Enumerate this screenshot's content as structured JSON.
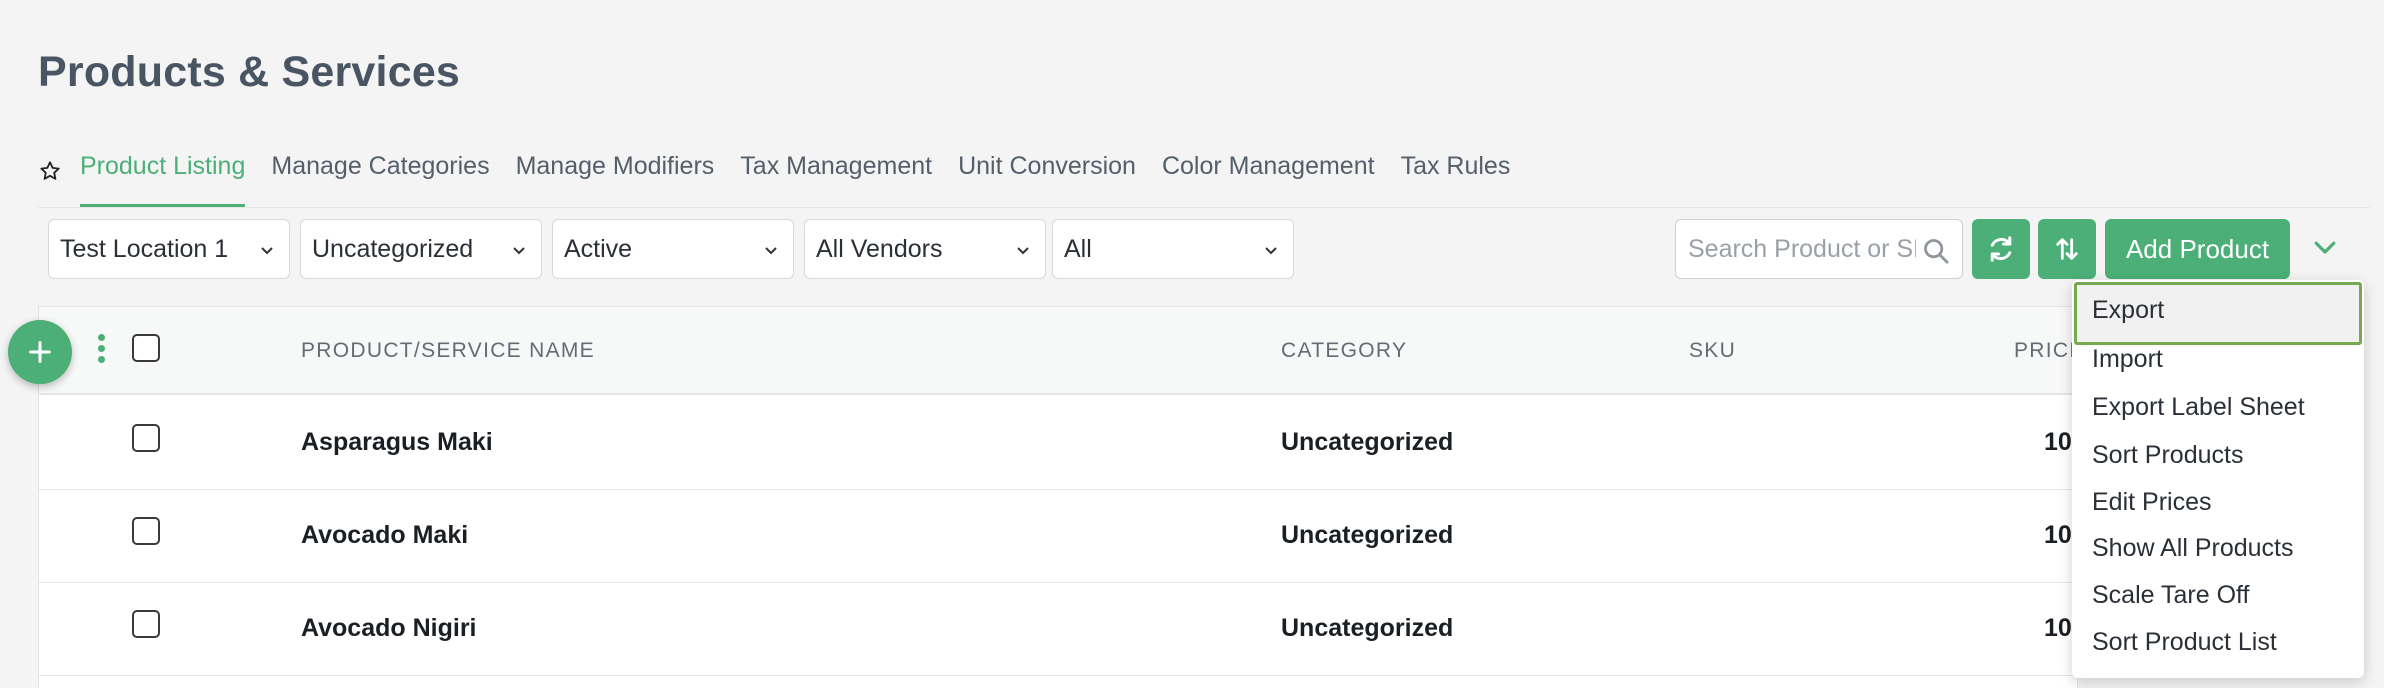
{
  "page": {
    "title": "Products & Services"
  },
  "tabs": [
    {
      "label": "Product Listing",
      "active": true
    },
    {
      "label": "Manage Categories"
    },
    {
      "label": "Manage Modifiers"
    },
    {
      "label": "Tax Management"
    },
    {
      "label": "Unit Conversion"
    },
    {
      "label": "Color Management"
    },
    {
      "label": "Tax Rules"
    }
  ],
  "filters": {
    "location": "Test Location 1",
    "category": "Uncategorized",
    "status": "Active",
    "vendor": "All Vendors",
    "type": "All"
  },
  "search": {
    "placeholder": "Search Product or SKU"
  },
  "toolbar": {
    "add_label": "Add Product"
  },
  "table": {
    "headers": {
      "name": "PRODUCT/SERVICE NAME",
      "category": "CATEGORY",
      "sku": "SKU",
      "price": "PRICE"
    },
    "rows": [
      {
        "name": "Asparagus Maki",
        "category": "Uncategorized",
        "sku": "",
        "price": "10"
      },
      {
        "name": "Avocado Maki",
        "category": "Uncategorized",
        "sku": "",
        "price": "10"
      },
      {
        "name": "Avocado Nigiri",
        "category": "Uncategorized",
        "sku": "",
        "price": "10"
      }
    ]
  },
  "menu": {
    "selected": "Export",
    "items": [
      "Export",
      "Import",
      "Export Label Sheet",
      "Sort Products",
      "Edit Prices",
      "Show All Products",
      "Scale Tare Off",
      "Sort Product List"
    ]
  },
  "colors": {
    "accent": "#4caf78",
    "selected_outline": "#74a94f"
  },
  "icons": [
    "star-icon",
    "chevron-down-icon",
    "search-icon",
    "refresh-icon",
    "sort-icon",
    "plus-icon",
    "kebab-icon"
  ]
}
